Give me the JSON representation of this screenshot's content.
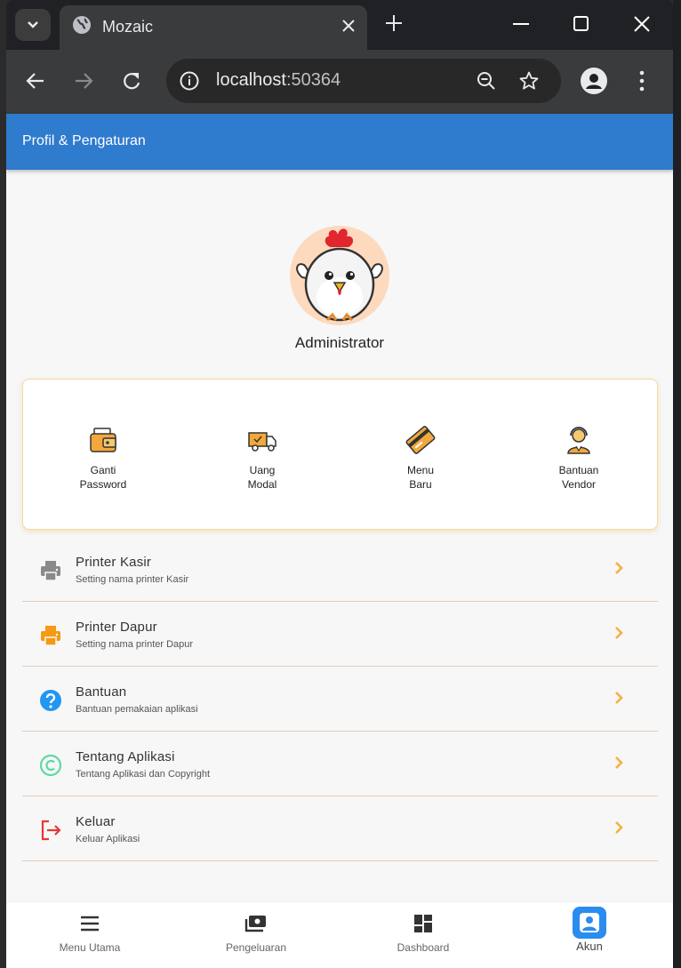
{
  "browser": {
    "tab_title": "Mozaic",
    "url_host": "localhost",
    "url_port": ":50364"
  },
  "app": {
    "appbar_title": "Profil & Pengaturan",
    "username": "Administrator"
  },
  "shortcuts": [
    {
      "line1": "Ganti",
      "line2": "Password",
      "icon": "wallet-icon"
    },
    {
      "line1": "Uang",
      "line2": "Modal",
      "icon": "delivery-truck-icon"
    },
    {
      "line1": "Menu",
      "line2": "Baru",
      "icon": "credit-card-icon"
    },
    {
      "line1": "Bantuan",
      "line2": "Vendor",
      "icon": "support-agent-icon"
    }
  ],
  "menu": [
    {
      "title": "Printer Kasir",
      "subtitle": "Setting nama printer Kasir",
      "icon": "printer-icon",
      "color": "#8a8a8a"
    },
    {
      "title": "Printer Dapur",
      "subtitle": "Setting nama printer Dapur",
      "icon": "printer-icon",
      "color": "#f59a14"
    },
    {
      "title": "Bantuan",
      "subtitle": "Bantuan pemakaian aplikasi",
      "icon": "help-icon",
      "color": "#2196f3"
    },
    {
      "title": "Tentang Aplikasi",
      "subtitle": "Tentang Aplikasi dan Copyright",
      "icon": "copyright-icon",
      "color": "#5ed8a0"
    },
    {
      "title": "Keluar",
      "subtitle": "Keluar Aplikasi",
      "icon": "logout-icon",
      "color": "#e53935"
    }
  ],
  "bottom_nav": [
    {
      "label": "Menu Utama",
      "icon": "menu-icon"
    },
    {
      "label": "Pengeluaran",
      "icon": "money-icon"
    },
    {
      "label": "Dashboard",
      "icon": "dashboard-icon"
    },
    {
      "label": "Akun",
      "icon": "account-icon",
      "active": true
    }
  ],
  "colors": {
    "appbar": "#2f7bcd",
    "chevron": "#f5b041",
    "active_nav": "#2a8cef"
  }
}
